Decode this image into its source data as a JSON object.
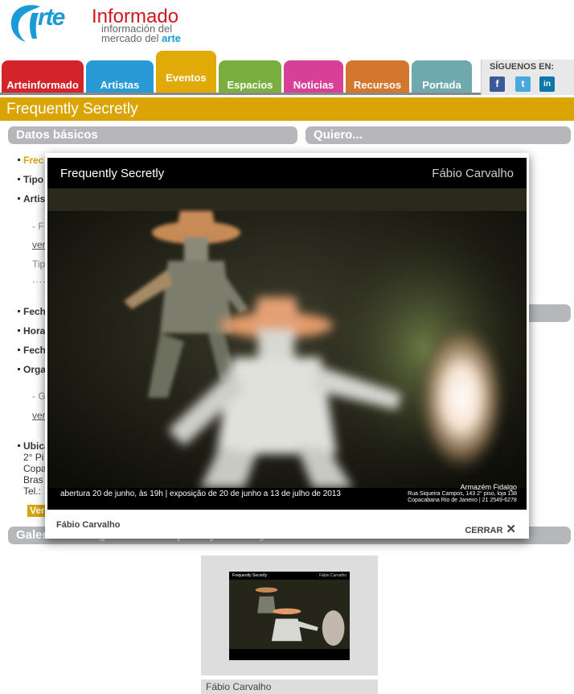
{
  "logo": {
    "rte": "rte",
    "informado": "Informado",
    "line1": "información del",
    "line2": "mercado del",
    "line2_accent": "arte"
  },
  "nav": {
    "tabs": [
      {
        "label": "Arteinformado",
        "color": "#d3242b"
      },
      {
        "label": "Artistas",
        "color": "#2a9ad6"
      },
      {
        "label": "Eventos",
        "color": "#e2aa08"
      },
      {
        "label": "Espacios",
        "color": "#7aae3e"
      },
      {
        "label": "Noticias",
        "color": "#d83f97"
      },
      {
        "label": "Recursos",
        "color": "#d3762e"
      },
      {
        "label": "Portada",
        "color": "#6fa9ae"
      }
    ],
    "active_tab": "Eventos",
    "follow_label": "SÍGUENOS EN:",
    "social": [
      {
        "name": "facebook-icon",
        "glyph": "f"
      },
      {
        "name": "twitter-icon",
        "glyph": "t"
      },
      {
        "name": "linkedin-icon",
        "glyph": "in"
      }
    ]
  },
  "page_title": "Frequently Secretly",
  "sections": {
    "basic": "Datos básicos",
    "quiero": "Quiero...",
    "gallery": "Galería de imágenes de Frequently Secretly"
  },
  "fragments": {
    "f1": "Frec",
    "f2": "Tipo",
    "f3": "Artis",
    "f4": "- F",
    "f5": "ver",
    "f6": "Tip",
    "f7": "Fech",
    "f8": "Hora",
    "f9": "Fech",
    "f10": "Orga",
    "f11": "- G",
    "f12": "ver",
    "f13": "Ubica",
    "f14": "2° Pi",
    "f15": "Copa",
    "f16": "Bras",
    "f17": "Tel.:",
    "f18": "Ver"
  },
  "lightbox": {
    "poster_title": "Frequently Secretly",
    "poster_artist": "Fábio Carvalho",
    "caption": "abertura 20 de junho, às 19h  |  exposição de 20 de junho a 13 de julho de 2013",
    "venue_name": "Armazém Fidalgo",
    "venue_line1": "Rua Siqueira Campos, 143  2° piso, loja 138",
    "venue_line2": "Copacabana  Rio de Janeiro | 21 2549-6278",
    "artist": "Fábio Carvalho",
    "close_label": "CERRAR",
    "close_glyph": "✕"
  },
  "gallery": {
    "thumb_title": "Frequently Secretly",
    "thumb_artist": "Fábio Carvalho",
    "caption": "Fábio Carvalho"
  }
}
